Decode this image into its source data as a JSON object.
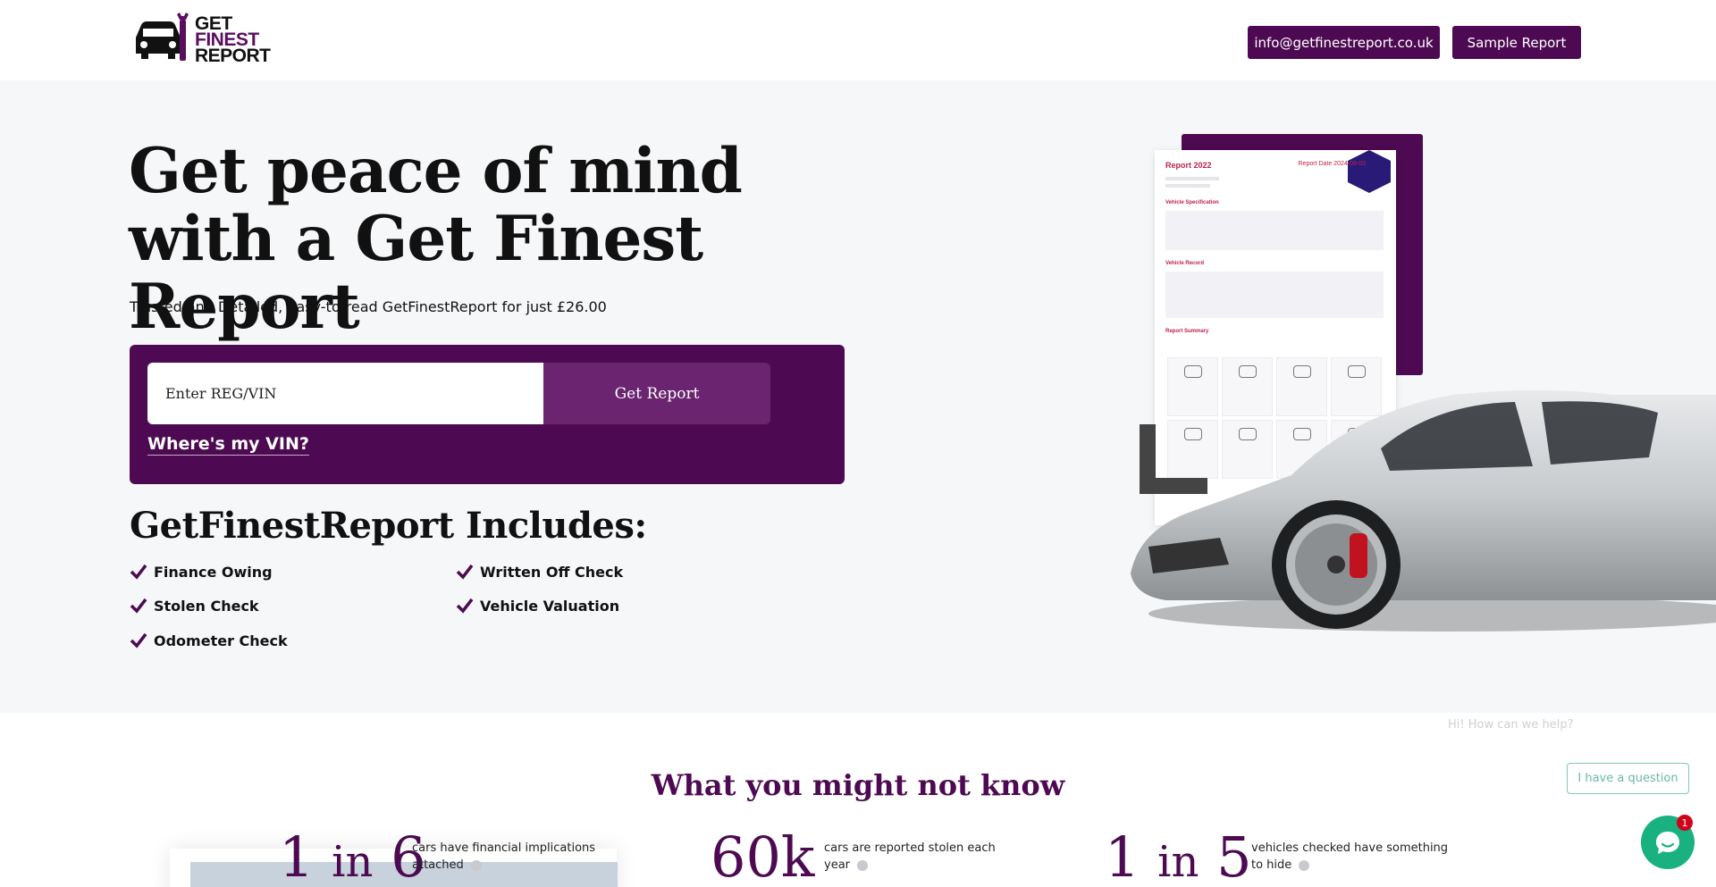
{
  "brand": {
    "logo_line1": "GET",
    "logo_line2": "FINEST",
    "logo_line3": "REPORT",
    "accent_color": "#4d0a52"
  },
  "header": {
    "email_button": "info@getfinestreport.co.uk",
    "sample_button": "Sample Report"
  },
  "hero": {
    "title": "Get peace of mind with a Get Finest Report",
    "subtitle": "Trusted and Detailed, Easy-to-read GetFinestReport for just £26.00",
    "search": {
      "placeholder": "Enter REG/VIN",
      "button": "Get Report",
      "vin_link": "Where's my VIN?"
    },
    "includes_title": "GetFinestReport Includes:",
    "includes": [
      "Finance Owing",
      "Written Off Check",
      "Stolen Check",
      "Vehicle Valuation",
      "Odometer Check"
    ]
  },
  "report_preview": {
    "title": "Report 2022",
    "date": "Report Date 2024-09-03",
    "sections": [
      "Vehicle Specification",
      "Vehicle Record",
      "Report Summary"
    ]
  },
  "stats": {
    "title": "What you might not know",
    "items": [
      {
        "num_a": "1",
        "num_mid": "in",
        "num_b": "6",
        "desc": "cars have financial implications attached"
      },
      {
        "num_a": "60k",
        "num_mid": "",
        "num_b": "",
        "desc": "cars are reported stolen each year"
      },
      {
        "num_a": "1",
        "num_mid": "in",
        "num_b": "5",
        "desc": "vehicles checked have something to hide"
      }
    ]
  },
  "chat": {
    "hint": "Hi! How can we help?",
    "question_button": "I have a question",
    "badge_count": "1"
  }
}
